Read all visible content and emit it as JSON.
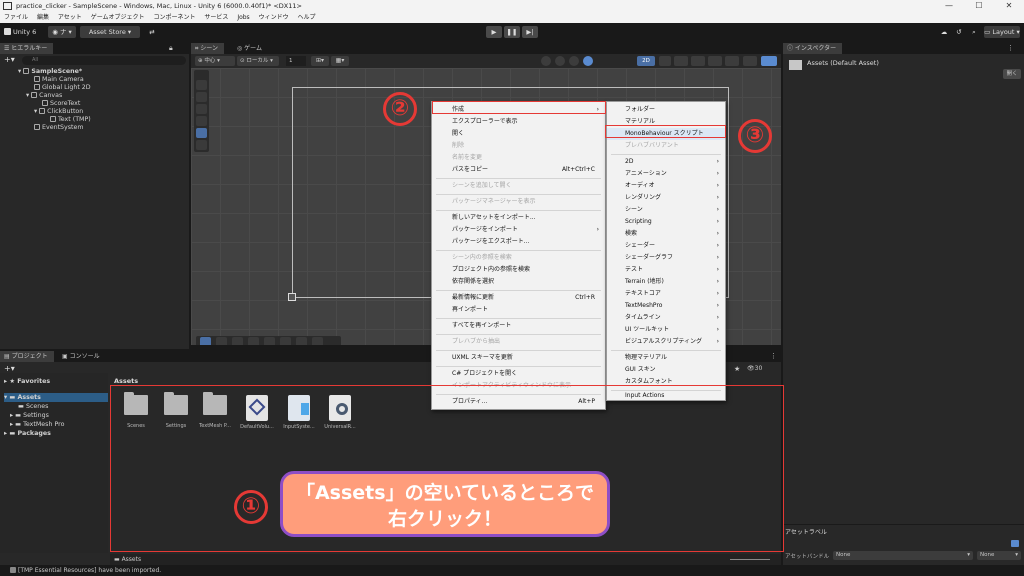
{
  "window": {
    "title": "practice_clicker - SampleScene - Windows, Mac, Linux - Unity 6 (6000.0.40f1)* <DX11>",
    "controls": [
      "—",
      "☐",
      "✕"
    ]
  },
  "menubar": [
    "ファイル",
    "編集",
    "アセット",
    "ゲームオブジェクト",
    "コンポーネント",
    "サービス",
    "Jobs",
    "ウィンドウ",
    "ヘルプ"
  ],
  "toolbar": {
    "unity_label": "Unity 6",
    "account_label": "ナ",
    "asset_store_label": "Asset Store",
    "layout_label": "Layout"
  },
  "hierarchy": {
    "tab": "ヒエラルキー",
    "search_placeholder": "All",
    "items": [
      {
        "label": "SampleScene*"
      },
      {
        "label": "Main Camera"
      },
      {
        "label": "Global Light 2D"
      },
      {
        "label": "Canvas"
      },
      {
        "label": "ScoreText"
      },
      {
        "label": "ClickButton"
      },
      {
        "label": "Text (TMP)"
      },
      {
        "label": "EventSystem"
      }
    ]
  },
  "scene": {
    "tabs": [
      "シーン",
      "ゲーム"
    ],
    "pivot_label": "中心",
    "space_label": "ローカル",
    "snap_value": "1",
    "mode_label": "2D"
  },
  "inspector": {
    "tab": "インスペクター",
    "title": "Assets (Default Asset)",
    "open_button": "開く",
    "asset_label_header": "アセットラベル",
    "asset_bundle_label": "アセットバンドル",
    "bundle_value": "None",
    "variant_value": "None"
  },
  "project": {
    "tabs": [
      "プロジェクト",
      "コンソール"
    ],
    "tree": [
      "Favorites",
      "Assets",
      "Scenes",
      "Settings",
      "TextMesh Pro",
      "Packages"
    ],
    "breadcrumb": "Assets",
    "count": "30",
    "footer_path": "Assets",
    "assets": [
      {
        "name": "Scenes",
        "icon": "folder-icon"
      },
      {
        "name": "Settings",
        "icon": "folder-icon"
      },
      {
        "name": "TextMesh P...",
        "icon": "folder-icon"
      },
      {
        "name": "DefaultVolu...",
        "icon": "volume-profile-icon"
      },
      {
        "name": "InputSyste...",
        "icon": "input-actions-icon"
      },
      {
        "name": "UniversalR...",
        "icon": "render-pipeline-icon"
      }
    ]
  },
  "context_menu": {
    "items": [
      {
        "label": "作成",
        "arrow": "›"
      },
      {
        "label": "エクスプローラーで表示"
      },
      {
        "label": "開く"
      },
      {
        "label": "削除",
        "disabled": true
      },
      {
        "label": "名前を変更",
        "disabled": true
      },
      {
        "label": "パスをコピー",
        "shortcut": "Alt+Ctrl+C"
      },
      {
        "label": "シーンを追加して開く",
        "disabled": true
      },
      {
        "label": "パッケージマネージャーを表示",
        "disabled": true
      },
      {
        "label": "新しいアセットをインポート..."
      },
      {
        "label": "パッケージをインポート",
        "arrow": "›"
      },
      {
        "label": "パッケージをエクスポート..."
      },
      {
        "label": "シーン内の参照を検索",
        "disabled": true
      },
      {
        "label": "プロジェクト内の参照を検索"
      },
      {
        "label": "依存関係を選択"
      },
      {
        "label": "最新情報に更新",
        "shortcut": "Ctrl+R"
      },
      {
        "label": "再インポート"
      },
      {
        "label": "すべてを再インポート"
      },
      {
        "label": "プレハブから抽出",
        "disabled": true
      },
      {
        "label": "UXML スキーマを更新"
      },
      {
        "label": "C# プロジェクトを開く"
      },
      {
        "label": "インポートアクティビティウィンドウに表示",
        "disabled": true
      },
      {
        "label": "プロパティ...",
        "shortcut": "Alt+P"
      }
    ]
  },
  "submenu": {
    "items": [
      {
        "label": "フォルダー"
      },
      {
        "label": "マテリアル"
      },
      {
        "label": "MonoBehaviour スクリプト"
      },
      {
        "label": "プレハブバリアント",
        "disabled": true
      },
      {
        "label": "2D",
        "arrow": "›"
      },
      {
        "label": "アニメーション",
        "arrow": "›"
      },
      {
        "label": "オーディオ",
        "arrow": "›"
      },
      {
        "label": "レンダリング",
        "arrow": "›"
      },
      {
        "label": "シーン",
        "arrow": "›"
      },
      {
        "label": "Scripting",
        "arrow": "›"
      },
      {
        "label": "検索",
        "arrow": "›"
      },
      {
        "label": "シェーダー",
        "arrow": "›"
      },
      {
        "label": "シェーダーグラフ",
        "arrow": "›"
      },
      {
        "label": "テスト",
        "arrow": "›"
      },
      {
        "label": "Terrain (地形)",
        "arrow": "›"
      },
      {
        "label": "テキストコア",
        "arrow": "›"
      },
      {
        "label": "TextMeshPro",
        "arrow": "›"
      },
      {
        "label": "タイムライン",
        "arrow": "›"
      },
      {
        "label": "UI ツールキット",
        "arrow": "›"
      },
      {
        "label": "ビジュアルスクリプティング",
        "arrow": "›"
      },
      {
        "label": "物理マテリアル"
      },
      {
        "label": "GUI スキン"
      },
      {
        "label": "カスタムフォント"
      },
      {
        "label": "Input Actions"
      }
    ]
  },
  "annotations": {
    "step1": "①",
    "step2": "②",
    "step3": "③",
    "callout_line1": "「Assets」の空いているところで",
    "callout_line2": "右クリック！",
    "accent_color": "#e53935",
    "callout_fill": "#ff9d7b",
    "callout_border": "#8e4ec6"
  },
  "statusbar": {
    "message": "[TMP Essential Resources] have been imported."
  }
}
